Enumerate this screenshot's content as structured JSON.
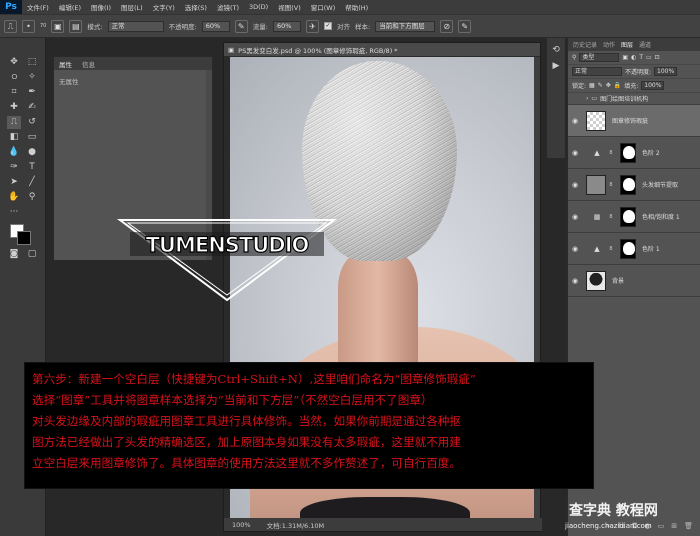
{
  "app": {
    "logo": "Ps"
  },
  "menu": [
    "文件(F)",
    "编辑(E)",
    "图像(I)",
    "图层(L)",
    "文字(Y)",
    "选择(S)",
    "滤镜(T)",
    "3D(D)",
    "视图(V)",
    "窗口(W)",
    "帮助(H)"
  ],
  "options_bar": {
    "brush_size": "70",
    "mode_label": "模式:",
    "mode_value": "正常",
    "opacity_label": "不透明度:",
    "opacity_value": "60%",
    "flow_label": "流量:",
    "flow_value": "60%",
    "aligned_label": "对齐",
    "sample_label": "样本:",
    "sample_value": "当前和下方图层"
  },
  "properties_panel": {
    "tabs": [
      "属性",
      "信息"
    ],
    "empty_text": "无属性"
  },
  "document": {
    "title": "PS黑发变白发.psd @ 100% (图章修饰瑕疵, RGB/8) *",
    "zoom": "100%",
    "doc_size": "文档:1.31M/6.10M",
    "logo_text": "TUMENSTUDIO"
  },
  "layers_panel": {
    "tabs": [
      "历史记录",
      "动作",
      "图层",
      "通道"
    ],
    "filter_kind": "类型",
    "blend_mode": "正常",
    "opacity_label": "不透明度:",
    "opacity_value": "100%",
    "lock_label": "锁定:",
    "fill_label": "填充:",
    "fill_value": "100%",
    "group_name": "图门绘图培训机构",
    "layers": [
      {
        "name": "图章修饰瑕疵"
      },
      {
        "name": "色阶 2"
      },
      {
        "name": "头发细节提取"
      },
      {
        "name": "色相/饱和度 1"
      },
      {
        "name": "色阶 1"
      },
      {
        "name": "背景"
      }
    ]
  },
  "caption": {
    "lines": [
      "第六步：新建一个空白层（快捷键为Ctrl+Shift+N）,这里咱们命名为“图章修饰瑕疵”",
      "选择“图章”工具并将图章样本选择为“当前和下方层”（不然空白层用不了图章）",
      "对头发边缘及内部的瑕疵用图章工具进行具体修饰。当然，如果你前期是通过各种抠",
      "图方法已经做出了头发的精确选区，加上原图本身如果没有太多瑕疵，这里就不用建",
      "立空白层来用图章修饰了。具体图章的使用方法这里就不多作赘述了，可自行百度。"
    ]
  },
  "watermark": {
    "line1": "查字典 教程网",
    "line2": "jiaocheng.chazidian.com"
  }
}
